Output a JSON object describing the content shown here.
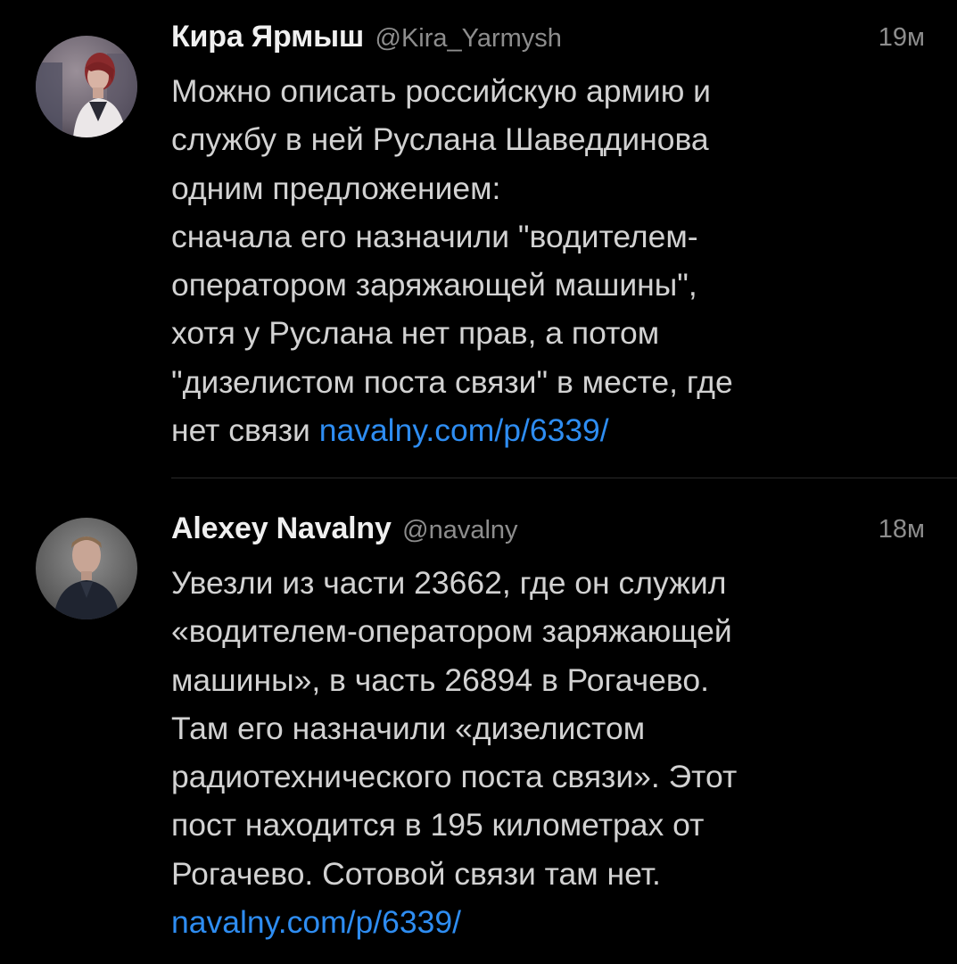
{
  "tweets": [
    {
      "display_name": "Кира Ярмыш",
      "handle": "@Kira_Yarmysh",
      "time": "19м",
      "lines": [
        "Можно описать российскую армию и",
        "службу в ней Руслана Шаведдинова",
        "одним предложением:",
        "сначала его назначили \"водителем-",
        "оператором заряжающей машины\",",
        "хотя у Руслана нет прав, а потом",
        "\"дизелистом поста связи\" в месте, где"
      ],
      "last_line_text": "нет связи ",
      "link": "navalny.com/p/6339/",
      "avatar_icon": "photo-avatar-woman"
    },
    {
      "display_name": "Alexey Navalny",
      "handle": "@navalny",
      "time": "18м",
      "lines": [
        "Увезли из части 23662, где он служил",
        "«водителем-оператором заряжающей",
        "машины», в часть 26894 в Рогачево.",
        "Там его назначили «дизелистом",
        "радиотехнического поста связи». Этот",
        "пост находится в 195 километрах от",
        "Рогачево. Сотовой связи там нет."
      ],
      "link": "navalny.com/p/6339/",
      "avatar_icon": "photo-avatar-man"
    }
  ],
  "colors": {
    "background": "#000000",
    "link": "#2e8df2",
    "text": "#d2d2d2",
    "muted": "#8d8d8d"
  }
}
